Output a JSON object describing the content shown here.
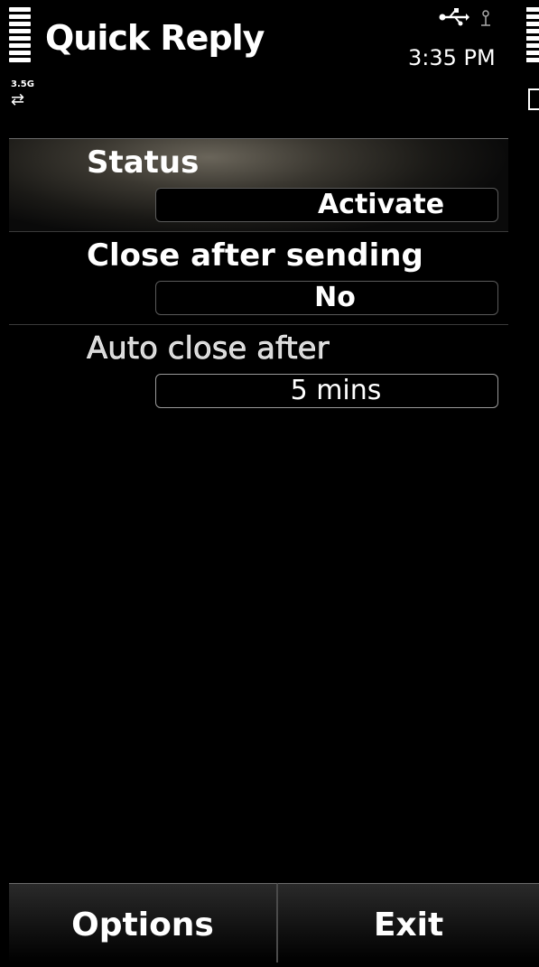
{
  "status_pane": {
    "title": "Quick Reply",
    "time": "3:35 PM",
    "network_label": "3.5G",
    "network_arrows": "⇄",
    "icons": [
      "signal-strength-icon",
      "usb-icon",
      "connectivity-icon",
      "battery-icon"
    ]
  },
  "settings": {
    "items": [
      {
        "label": "Status",
        "value": "Activate"
      },
      {
        "label": "Close after sending",
        "value": "No"
      },
      {
        "label": "Auto close after",
        "value": "5 mins"
      }
    ]
  },
  "softkeys": {
    "left": "Options",
    "right": "Exit"
  }
}
